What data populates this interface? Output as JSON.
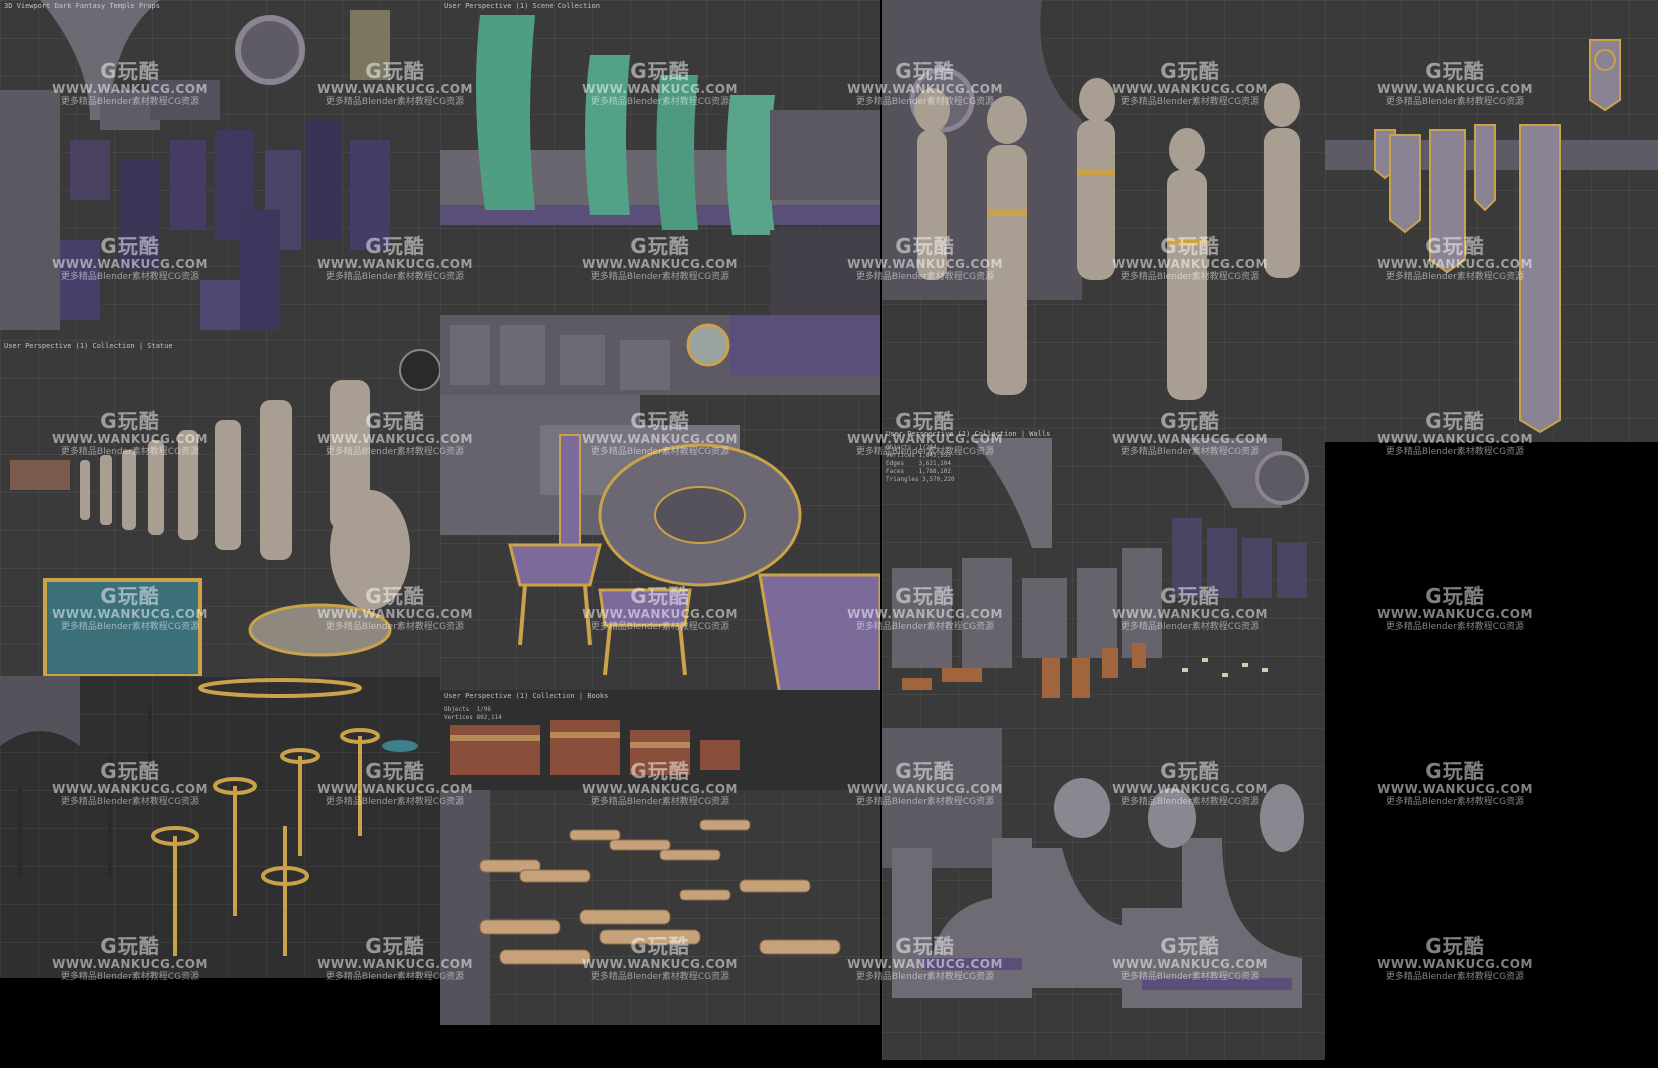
{
  "watermark": {
    "logo": "G玩酷",
    "url": "WWW.WANKUCG.COM",
    "sub": "更多精品Blender素材教程CG资源"
  },
  "panels": {
    "pillars": {
      "header": "3D Viewport   Dark Fantasy Temple Props"
    },
    "curtains": {
      "header": "User Perspective  (1) Scene Collection"
    },
    "statues": {
      "header": ""
    },
    "banners": {
      "header": ""
    },
    "statue_row": {
      "header": "User Perspective  (1) Collection | Statue"
    },
    "furniture": {
      "header": ""
    },
    "walls": {
      "header": "User Perspective  (1) Collection | Walls",
      "stats": "Objects  1/204\nVertices 1,843,553\nEdges    3,621,104\nFaces    1,788,102\nTriangles 3,570,220"
    },
    "candles": {
      "header": ""
    },
    "scrolls": {
      "header": "User Perspective  (1) Collection | Books",
      "stats": "Objects  1/96\nVertices 802,114"
    },
    "arches": {
      "header": ""
    }
  }
}
